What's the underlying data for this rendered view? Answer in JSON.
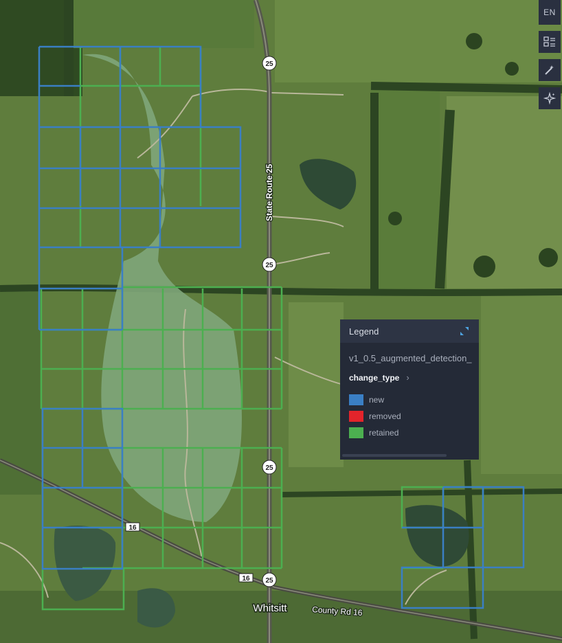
{
  "toolbar": {
    "language": "EN",
    "icons": [
      "layer-list-icon",
      "wand-icon",
      "sparkle-icon"
    ]
  },
  "map": {
    "place_labels": {
      "town": "Whitsitt",
      "highway": "State Route 25",
      "county_road": "County Rd 16"
    },
    "route_shields": {
      "sr25": "25",
      "cr16": "16"
    }
  },
  "legend": {
    "title": "Legend",
    "layer_name": "v1_0.5_augmented_detection_",
    "field": "change_type",
    "items": [
      {
        "label": "new",
        "color": "#3a7fc4"
      },
      {
        "label": "removed",
        "color": "#e3242b"
      },
      {
        "label": "retained",
        "color": "#4caf50"
      }
    ]
  },
  "colors": {
    "new": "#3a7fc4",
    "removed": "#e3242b",
    "retained": "#4caf50",
    "panel": "#242a37"
  }
}
